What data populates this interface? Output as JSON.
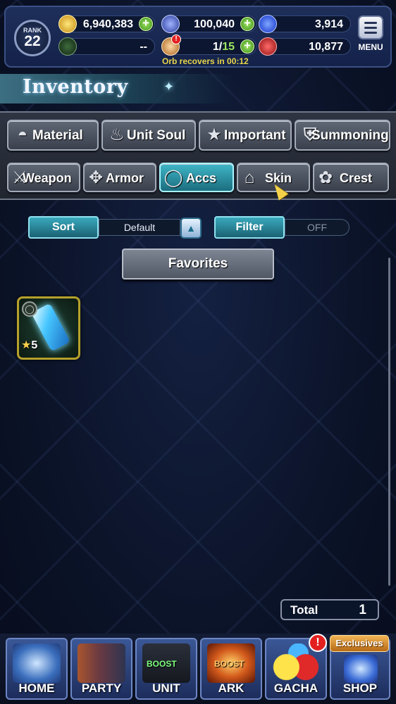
{
  "status": {
    "rank_label": "RANK",
    "rank_value": "22",
    "gil": "6,940,383",
    "lapis": "100,040",
    "blue_orb": "3,914",
    "clock_value": "--",
    "stamina": "1/",
    "stamina_max": "15",
    "red_orb": "10,877",
    "orb_recover": "Orb recovers in 00:12",
    "alert_mark": "!"
  },
  "menu": {
    "label": "MENU"
  },
  "inventory": {
    "title": "Inventory"
  },
  "categories_row1": [
    {
      "label": "Material",
      "icon": "bag-icon",
      "glyph": "◓"
    },
    {
      "label": "Unit Soul",
      "icon": "flame-icon",
      "glyph": "♨"
    },
    {
      "label": "Important",
      "icon": "star-icon",
      "glyph": "★"
    },
    {
      "label": "Summoning",
      "icon": "shield-icon",
      "glyph": "⛨"
    }
  ],
  "categories_row2": [
    {
      "label": "Weapon",
      "icon": "sword-icon",
      "glyph": "⚔"
    },
    {
      "label": "Armor",
      "icon": "armor-icon",
      "glyph": "✥"
    },
    {
      "label": "Accs",
      "icon": "ring-icon",
      "glyph": "◯",
      "active": true
    },
    {
      "label": "Skin",
      "icon": "hanger-icon",
      "glyph": "⌂"
    },
    {
      "label": "Crest",
      "icon": "crest-icon",
      "glyph": "✿"
    }
  ],
  "sort": {
    "label": "Sort",
    "value": "Default",
    "toggle_glyph": "▲"
  },
  "filter": {
    "label": "Filter",
    "value": "OFF"
  },
  "favorites": {
    "label": "Favorites"
  },
  "item": {
    "rarity": "5",
    "star": "★"
  },
  "total": {
    "label": "Total",
    "value": "1"
  },
  "nav": {
    "home": "HOME",
    "party": "PARTY",
    "unit": "UNIT",
    "unit_boost": "BOOST",
    "ark": "ARK",
    "ark_boost": "BOOST",
    "gacha": "GACHA",
    "shop": "SHOP",
    "exclusives": "Exclusives",
    "gacha_alert": "!"
  },
  "colors": {
    "accent_cyan": "#3fb6c7",
    "gold_border": "#b6a12c",
    "plus_green": "#6cc23a"
  }
}
